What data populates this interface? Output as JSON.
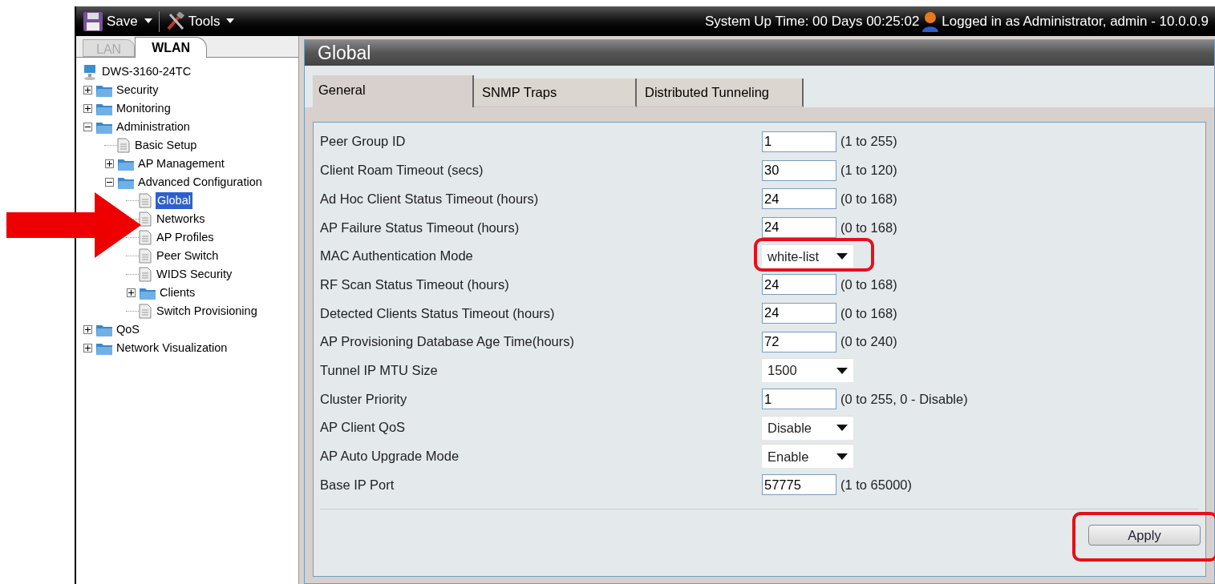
{
  "toolbar": {
    "menus": [
      {
        "label": "Save",
        "kind": "save"
      },
      {
        "label": "Tools",
        "kind": "tools"
      }
    ],
    "uptime": "System Up Time: 00 Days 00:25:02",
    "user": "Logged in as Administrator, admin - 10.0.0.9"
  },
  "sidebar": {
    "tabs": [
      {
        "label": "LAN",
        "selected": false
      },
      {
        "label": "WLAN",
        "selected": true
      }
    ],
    "tree": [
      {
        "label": "DWS-3160-24TC",
        "kind": "device",
        "children": [
          {
            "label": "Security",
            "kind": "folder",
            "expanded": false
          },
          {
            "label": "Monitoring",
            "kind": "folder",
            "expanded": false
          },
          {
            "label": "Administration",
            "kind": "folder",
            "expanded": true,
            "children": [
              {
                "label": "Basic Setup",
                "kind": "page",
                "selected": false
              },
              {
                "label": "AP Management",
                "kind": "folder",
                "expanded": false
              },
              {
                "label": "Advanced Configuration",
                "kind": "folder",
                "expanded": true,
                "children": [
                  {
                    "label": "Global",
                    "kind": "page",
                    "selected": true,
                    "callout": true
                  },
                  {
                    "label": "Networks",
                    "kind": "page",
                    "selected": false
                  },
                  {
                    "label": "AP Profiles",
                    "kind": "page",
                    "selected": false
                  },
                  {
                    "label": "Peer Switch",
                    "kind": "page",
                    "selected": false
                  },
                  {
                    "label": "WIDS Security",
                    "kind": "page",
                    "selected": false
                  },
                  {
                    "label": "Clients",
                    "kind": "folder",
                    "expanded": false
                  },
                  {
                    "label": "Switch Provisioning",
                    "kind": "page",
                    "selected": false
                  }
                ]
              }
            ]
          },
          {
            "label": "QoS",
            "kind": "folder",
            "expanded": false
          },
          {
            "label": "Network Visualization",
            "kind": "folder",
            "expanded": false
          }
        ]
      }
    ]
  },
  "panel": {
    "title": "Global",
    "tabs": [
      {
        "label": "General",
        "selected": true
      },
      {
        "label": "SNMP Traps",
        "selected": false
      },
      {
        "label": "Distributed Tunneling",
        "selected": false
      }
    ],
    "fields": [
      {
        "label": "Peer Group ID",
        "kind": "text",
        "value": "1",
        "hint": "(1 to 255)"
      },
      {
        "label": "Client Roam Timeout (secs)",
        "kind": "text",
        "value": "30",
        "hint": "(1 to 120)"
      },
      {
        "label": "Ad Hoc Client Status Timeout (hours)",
        "kind": "text",
        "value": "24",
        "hint": "(0 to 168)"
      },
      {
        "label": "AP Failure Status Timeout (hours)",
        "kind": "text",
        "value": "24",
        "hint": "(0 to 168)"
      },
      {
        "label": "MAC Authentication Mode",
        "kind": "select",
        "value": "white-list",
        "callout": true
      },
      {
        "label": "RF Scan Status Timeout (hours)",
        "kind": "text",
        "value": "24",
        "hint": "(0 to 168)"
      },
      {
        "label": "Detected Clients Status Timeout (hours)",
        "kind": "text",
        "value": "24",
        "hint": "(0 to 168)"
      },
      {
        "label": "AP Provisioning Database Age Time(hours)",
        "kind": "text",
        "value": "72",
        "hint": "(0 to 240)"
      },
      {
        "label": "Tunnel IP MTU Size",
        "kind": "select",
        "value": "1500"
      },
      {
        "label": "Cluster Priority",
        "kind": "text",
        "value": "1",
        "hint": "(0 to 255, 0 - Disable)"
      },
      {
        "label": "AP Client QoS",
        "kind": "select",
        "value": "Disable"
      },
      {
        "label": "AP Auto Upgrade Mode",
        "kind": "select",
        "value": "Enable"
      },
      {
        "label": "Base IP Port",
        "kind": "text",
        "value": "57775",
        "hint": "(1 to 65000)"
      }
    ],
    "apply": {
      "label": "Apply",
      "callout": true
    }
  }
}
